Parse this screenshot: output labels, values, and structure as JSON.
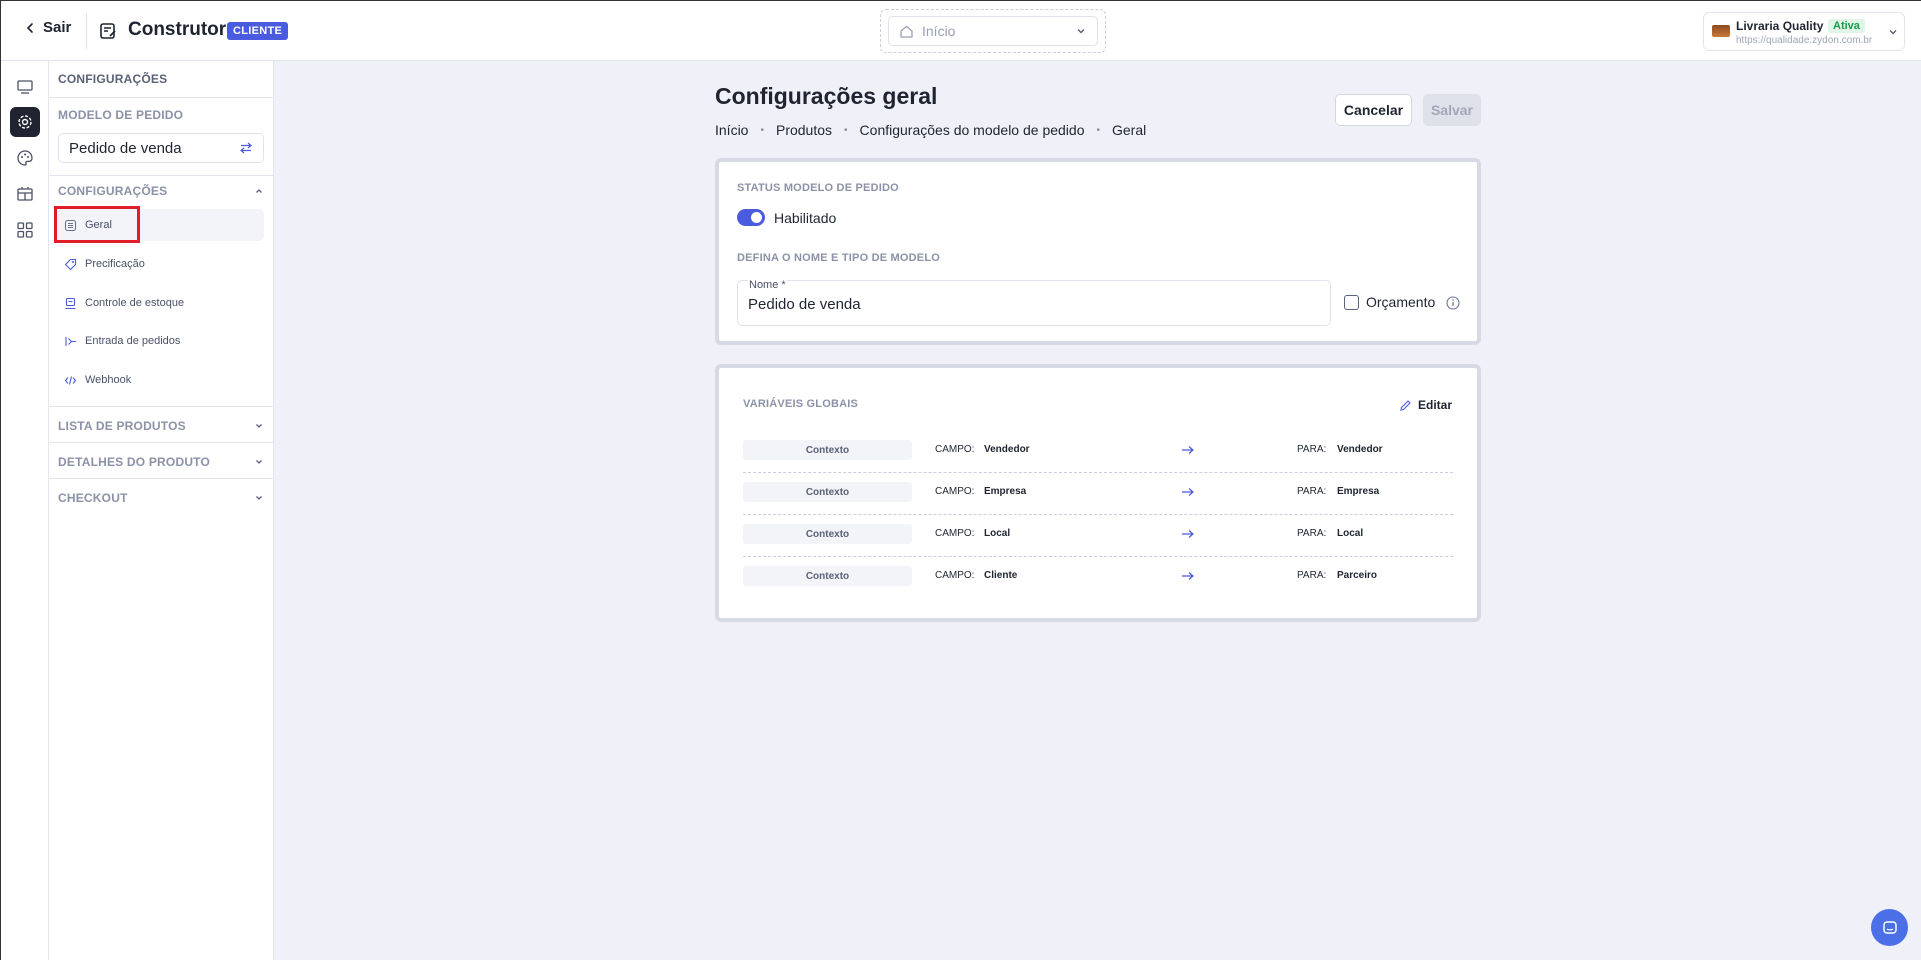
{
  "header": {
    "back_label": "Sair",
    "title": "Construtor",
    "badge": "CLIENTE",
    "page_select": {
      "value": "Início"
    },
    "store": {
      "name": "Livraria Quality",
      "status": "Ativa",
      "url": "https://qualidade.zydon.com.br"
    }
  },
  "rail": {
    "icons": [
      "layout-icon",
      "gear-icon",
      "palette-icon",
      "building-icon",
      "grid-icon"
    ],
    "active": "gear-icon"
  },
  "sidebar": {
    "title": "CONFIGURAÇÕES",
    "model_label": "MODELO DE PEDIDO",
    "model_value": "Pedido de venda",
    "config_section": "CONFIGURAÇÕES",
    "items": [
      {
        "label": "Geral",
        "icon": "list-icon",
        "active": true
      },
      {
        "label": "Precificação",
        "icon": "tag-icon"
      },
      {
        "label": "Controle de estoque",
        "icon": "box-icon"
      },
      {
        "label": "Entrada de pedidos",
        "icon": "inbox-icon"
      },
      {
        "label": "Webhook",
        "icon": "code-icon"
      }
    ],
    "sections": [
      "LISTA DE PRODUTOS",
      "DETALHES DO PRODUTO",
      "CHECKOUT"
    ]
  },
  "main": {
    "title": "Configurações geral",
    "breadcrumb": [
      "Início",
      "Produtos",
      "Configurações do modelo de pedido",
      "Geral"
    ],
    "cancel_label": "Cancelar",
    "save_label": "Salvar",
    "status_card": {
      "status_label": "STATUS MODELO DE PEDIDO",
      "toggle_label": "Habilitado",
      "toggle_on": true,
      "name_section_label": "DEFINA O NOME E TIPO DE MODELO",
      "name_field_label": "Nome *",
      "name_value": "Pedido de venda",
      "checkbox_label": "Orçamento",
      "checkbox_checked": false
    },
    "variables_card": {
      "title": "VARIÁVEIS GLOBAIS",
      "edit_label": "Editar",
      "field_key": "CAMPO:",
      "to_key": "PARA:",
      "rows": [
        {
          "context": "Contexto",
          "campo": "Vendedor",
          "para": "Vendedor"
        },
        {
          "context": "Contexto",
          "campo": "Empresa",
          "para": "Empresa"
        },
        {
          "context": "Contexto",
          "campo": "Local",
          "para": "Local"
        },
        {
          "context": "Contexto",
          "campo": "Cliente",
          "para": "Parceiro"
        }
      ]
    }
  },
  "colors": {
    "accent": "#4b5be0",
    "status_green": "#1a9a4a",
    "highlight_red": "#e11d2a"
  }
}
